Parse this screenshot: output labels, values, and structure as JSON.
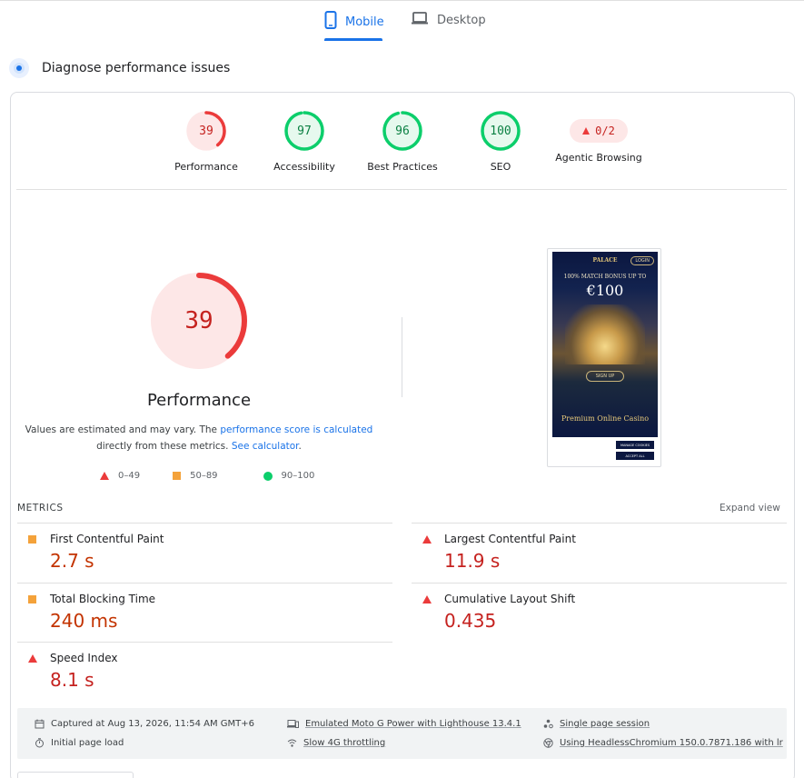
{
  "tabs": [
    {
      "label": "Mobile",
      "active": true,
      "icon": "phone-icon"
    },
    {
      "label": "Desktop",
      "active": false,
      "icon": "laptop-icon"
    }
  ],
  "diagnose": {
    "title": "Diagnose performance issues",
    "icon": "lighthouse-icon"
  },
  "categories": [
    {
      "score": "39",
      "label": "Performance",
      "status": "fail",
      "color": "#eb3b3b",
      "fill": 0.39
    },
    {
      "score": "97",
      "label": "Accessibility",
      "status": "pass",
      "color": "#0cce6b",
      "fill": 0.97
    },
    {
      "score": "96",
      "label": "Best Practices",
      "status": "pass",
      "color": "#0cce6b",
      "fill": 0.96
    },
    {
      "score": "100",
      "label": "SEO",
      "status": "pass",
      "color": "#0cce6b",
      "fill": 1.0
    },
    {
      "score": "0/2",
      "label": "Agentic Browsing",
      "status": "fail",
      "color": "#eb3b3b"
    }
  ],
  "performance": {
    "score": "39",
    "fill": 0.39,
    "title": "Performance",
    "desc_prefix": "Values are estimated and may vary. The ",
    "desc_link1": "performance score is calculated",
    "desc_mid": "directly from these metrics. ",
    "desc_link2": "See calculator",
    "desc_suffix": "."
  },
  "legend": [
    {
      "shape": "triangle",
      "range": "0–49",
      "color": "#eb3b3b"
    },
    {
      "shape": "square",
      "range": "50–89",
      "color": "#f4a23a"
    },
    {
      "shape": "circle",
      "range": "90–100",
      "color": "#0cce6b"
    }
  ],
  "screenshot": {
    "brand": "PALACE",
    "login": "LOGIN",
    "bonus": "100% MATCH BONUS UP TO",
    "amount": "€100",
    "signup": "SIGN UP",
    "premium": "Premium Online Casino",
    "cookie_btn1": "MANAGE COOKIES",
    "cookie_btn2": "ACCEPT ALL"
  },
  "metrics_section": {
    "label": "METRICS",
    "expand": "Expand view"
  },
  "metrics": [
    {
      "name": "First Contentful Paint",
      "value": "2.7 s",
      "status": "average"
    },
    {
      "name": "Largest Contentful Paint",
      "value": "11.9 s",
      "status": "fail"
    },
    {
      "name": "Total Blocking Time",
      "value": "240 ms",
      "status": "average"
    },
    {
      "name": "Cumulative Layout Shift",
      "value": "0.435",
      "status": "fail"
    },
    {
      "name": "Speed Index",
      "value": "8.1 s",
      "status": "fail"
    }
  ],
  "footer": {
    "captured": "Captured at Aug 13, 2026, 11:54 AM GMT+6",
    "initial_load": "Initial page load",
    "device": "Emulated Moto G Power with Lighthouse 13.4.1",
    "throttling": "Slow 4G throttling",
    "session": "Single page session",
    "browser": "Using HeadlessChromium 150.0.7871.186 with lr"
  }
}
